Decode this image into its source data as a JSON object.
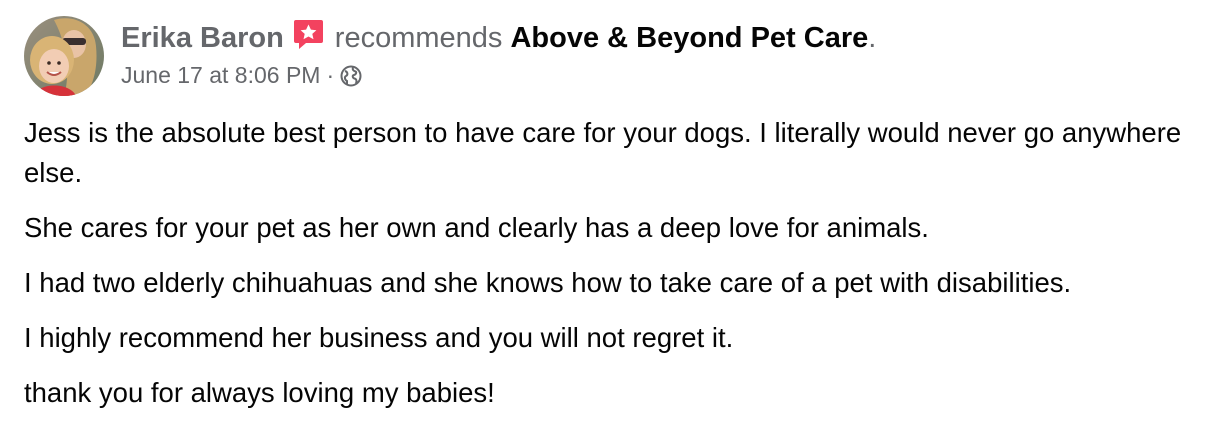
{
  "post": {
    "author_name": "Erika Baron",
    "action_verb": "recommends",
    "page_name": "Above & Beyond Pet Care",
    "punctuation": ".",
    "timestamp": "June 17 at 8:06 PM",
    "separator": "·",
    "privacy_icon": "globe-icon",
    "badge_icon": "recommendation-star-icon",
    "paragraphs": [
      "Jess is the absolute best person to have care for your dogs. I literally would never go anywhere else.",
      "She cares for your pet as her own and clearly has a deep love for animals.",
      "I had two elderly chihuahuas and she knows how to take care of a pet with disabilities.",
      "I highly recommend her business and you will not regret it.",
      "thank you for always loving my babies!"
    ]
  },
  "colors": {
    "secondary_text": "#65676b",
    "primary_text": "#050505",
    "badge": "#f3425f"
  }
}
